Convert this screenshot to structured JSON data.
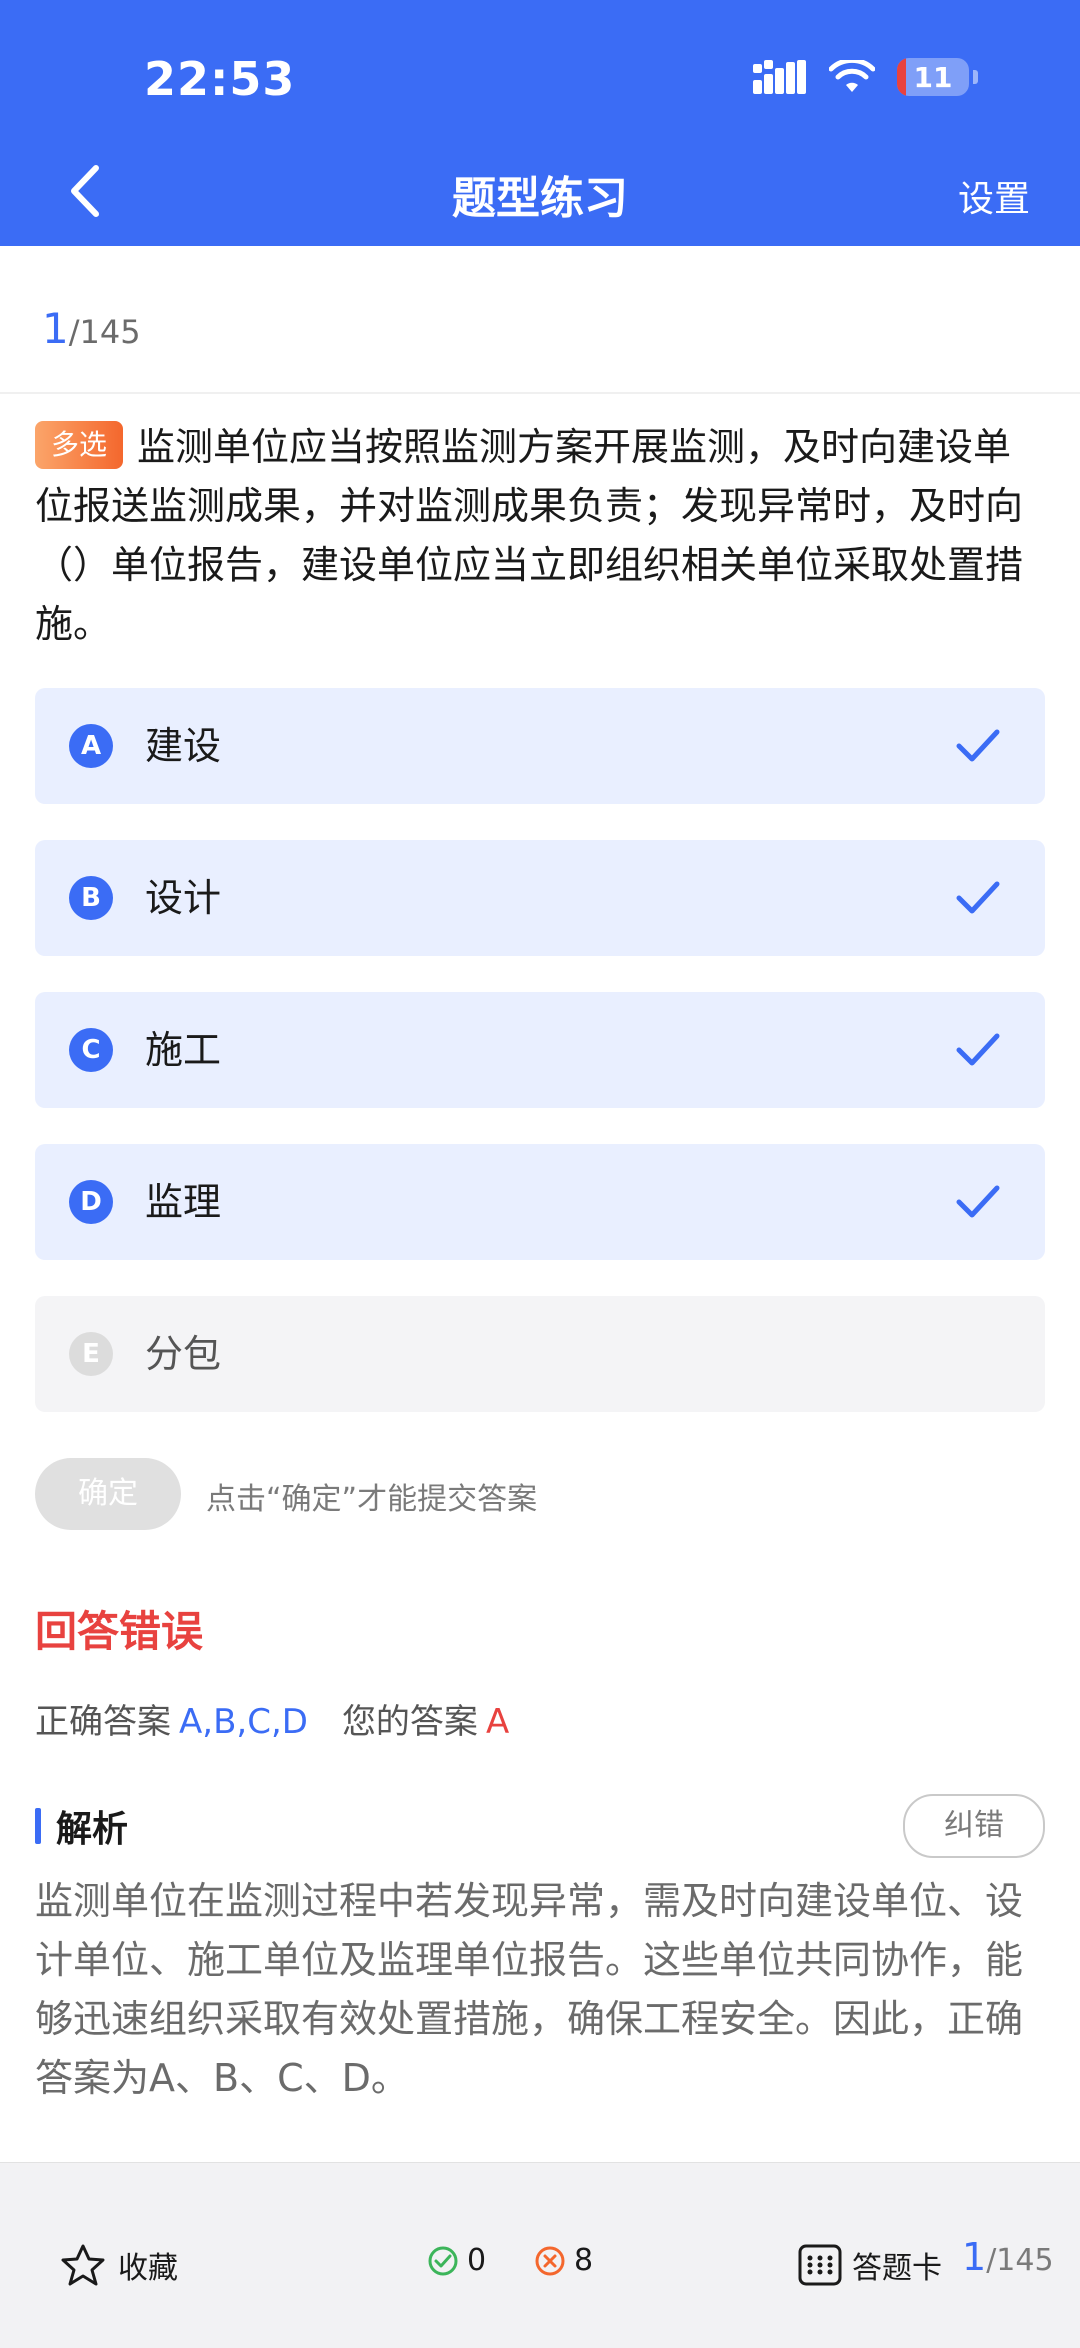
{
  "status_bar": {
    "time": "22:53",
    "battery": "11",
    "battery_level": 0.11
  },
  "nav": {
    "title": "题型练习",
    "settings_label": "设置"
  },
  "progress": {
    "current": "1",
    "total": "/145"
  },
  "question": {
    "type_tag": "多选",
    "text": "监测单位应当按照监测方案开展监测，及时向建设单位报送监测成果，并对监测成果负责；发现异常时，及时向（）单位报告，建设单位应当立即组织相关单位采取处置措施。"
  },
  "options": [
    {
      "letter": "A",
      "text": "建设"
    },
    {
      "letter": "B",
      "text": "设计"
    },
    {
      "letter": "C",
      "text": "施工"
    },
    {
      "letter": "D",
      "text": "监理"
    },
    {
      "letter": "E",
      "text": "分包"
    }
  ],
  "confirm": {
    "label": "确定",
    "hint": "点击“确定”才能提交答案"
  },
  "result": {
    "title": "回答错误",
    "correct_label": "正确答案",
    "correct_value": "A,B,C,D",
    "your_label": "您的答案",
    "your_value": "A"
  },
  "analysis": {
    "title": "解析",
    "report_label": "纠错",
    "text": "监测单位在监测过程中若发现异常，需及时向建设单位、设计单位、施工单位及监理单位报告。这些单位共同协作，能够迅速组织采取有效处置措施，确保工程安全。因此，正确答案为A、B、C、D。"
  },
  "bottom_bar": {
    "favorite_label": "收藏",
    "right_count": "0",
    "wrong_count": "8",
    "answer_card_label": "答题卡",
    "progress_current": "1",
    "progress_total": "/145"
  },
  "colors": {
    "primary": "#3b6cf5",
    "error": "#e8423f",
    "selected_bg": "#e9efff",
    "tag_orange": "#f4672d",
    "right_green": "#3cb55a"
  }
}
